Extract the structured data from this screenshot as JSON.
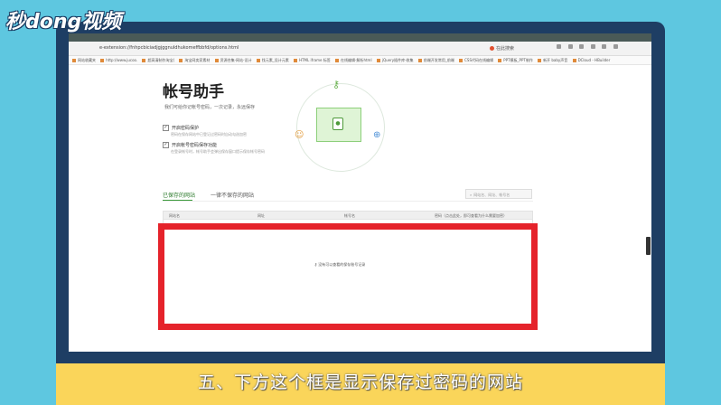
{
  "overlay": {
    "logo": "秒dong视频",
    "caption": "五、下方这个框是显示保存过密码的网站"
  },
  "browser": {
    "url": "e-extension://fnhpcbiciadjgjggnuldhukomeffbbfd/options.html",
    "search_engine": "在此搜索",
    "bookmarks": [
      "网站收藏夹",
      "http://www.jucoo.",
      "超高清制作淘宝(",
      "淘宝网卖家素材",
      "资源合集-网站-设计",
      "找元素_设计元素",
      "HTML iframe 标签",
      "在线编辑-解析html",
      "jQuery插件库-收集",
      "前端开发常用_前端",
      "CSS代码在线编辑",
      "PPT模板_PPT制作",
      "新开 baby声音",
      "DCloud - HBuilder"
    ]
  },
  "page": {
    "title": "帐号助手",
    "desc": "我们可给你记帐号密码，一次记录，永远保存",
    "options": [
      {
        "label": "开启密码保护",
        "sub": "密码在保存网站中已登记过密码时自动勾选加密",
        "checked": "✓"
      },
      {
        "label": "开启帐号密码保存功能",
        "sub": "在登录帐号时，帐号助手会弹出保存窗口提示保存帐号密码",
        "checked": "✓"
      }
    ],
    "tabs": {
      "saved": "已保存的网站",
      "never": "一律不保存的网站"
    },
    "search_placeholder": "网站名、网址、帐号名",
    "table": {
      "headers": [
        "网站名",
        "网址",
        "帐号名",
        "密码（点击此处，即可查看为什么需要加密）"
      ],
      "empty": "没有可以查看的保存账号记录"
    }
  },
  "colors": {
    "highlight": "#e5232b",
    "accent_green": "#3b9a3b",
    "monitor": "#1e3e64",
    "background": "#5ec7e0",
    "caption_bar": "#fad55a"
  }
}
